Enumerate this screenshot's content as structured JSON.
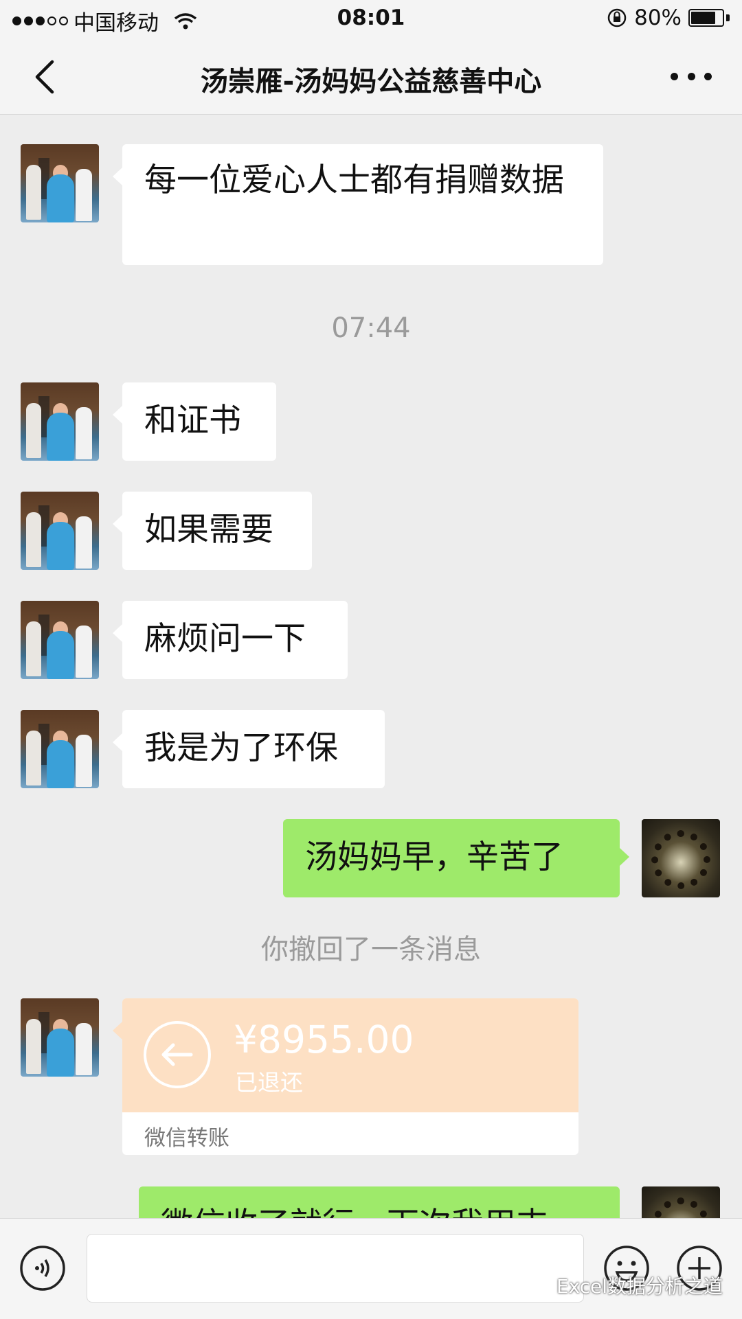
{
  "status_bar": {
    "carrier": "中国移动",
    "time": "08:01",
    "battery": "80%",
    "battery_level": 0.8,
    "signal_bars_filled": 3,
    "signal_bars_total": 5
  },
  "nav": {
    "title": "汤崇雁-汤妈妈公益慈善中心"
  },
  "messages": [
    {
      "side": "left",
      "text": "每一位爱心人士都有捐赠数据"
    },
    {
      "type": "time",
      "text": "07:44"
    },
    {
      "side": "left",
      "text": "和证书"
    },
    {
      "side": "left",
      "text": "如果需要"
    },
    {
      "side": "left",
      "text": "麻烦问一下"
    },
    {
      "side": "left",
      "text": "我是为了环保"
    },
    {
      "side": "right",
      "text": "汤妈妈早，辛苦了"
    },
    {
      "type": "system",
      "text": "你撤回了一条消息"
    },
    {
      "side": "left",
      "type": "transfer",
      "amount": "¥8955.00",
      "status": "已退还",
      "label": "微信转账"
    },
    {
      "side": "right",
      "text": "微信收了就行，下次我用支"
    }
  ],
  "watermark": "Excel数据分析之道",
  "colors": {
    "background": "#ededed",
    "bubble_sent": "#9eea6a",
    "bubble_received": "#ffffff",
    "transfer_refunded": "#fde0c4"
  }
}
